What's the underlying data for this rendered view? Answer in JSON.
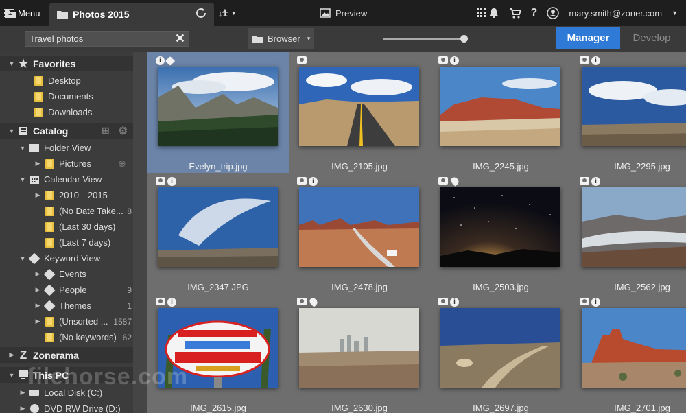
{
  "titlebar": {
    "menu_label": "Menu",
    "tab_title": "Photos 2015",
    "account": "mary.smith@zoner.com"
  },
  "toolbar": {
    "search_value": "Travel photos",
    "browser_label": "Browser",
    "preview_label": "Preview",
    "manager_label": "Manager",
    "develop_label": "Develop",
    "accent": "#2f7ad6"
  },
  "sidebar": {
    "favorites": "Favorites",
    "desktop": "Desktop",
    "documents": "Documents",
    "downloads": "Downloads",
    "catalog": "Catalog",
    "folder_view": "Folder View",
    "pictures": "Pictures",
    "calendar_view": "Calendar View",
    "cal_items": [
      {
        "label": "2010—2015",
        "count": ""
      },
      {
        "label": "(No Date Take...",
        "count": "8"
      },
      {
        "label": "(Last 30 days)",
        "count": ""
      },
      {
        "label": "(Last 7 days)",
        "count": ""
      }
    ],
    "keyword_view": "Keyword View",
    "kw_items": [
      {
        "label": "Events",
        "count": ""
      },
      {
        "label": "People",
        "count": "9"
      },
      {
        "label": "Themes",
        "count": "1"
      },
      {
        "label": "(Unsorted ...",
        "count": "1587"
      },
      {
        "label": "(No keywords)",
        "count": "62"
      }
    ],
    "zonerama": "Zonerama",
    "this_pc": "This PC",
    "local_disk": "Local Disk (C:)",
    "dvd": "DVD RW Drive (D:)"
  },
  "files": [
    {
      "name": "Evelyn_trip.jpg",
      "meta": [
        "info",
        "tag"
      ],
      "selected": true
    },
    {
      "name": "IMG_2105.jpg",
      "meta": [
        "camera"
      ]
    },
    {
      "name": "IMG_2245.jpg",
      "meta": [
        "camera",
        "info"
      ]
    },
    {
      "name": "IMG_2295.jpg",
      "meta": [
        "camera",
        "info"
      ]
    },
    {
      "name": "IMG_2347.JPG",
      "meta": [
        "camera",
        "info"
      ]
    },
    {
      "name": "IMG_2478.jpg",
      "meta": [
        "camera",
        "info"
      ]
    },
    {
      "name": "IMG_2503.jpg",
      "meta": [
        "camera",
        "pin"
      ]
    },
    {
      "name": "IMG_2562.jpg",
      "meta": [
        "camera",
        "info"
      ]
    },
    {
      "name": "IMG_2615.jpg",
      "meta": [
        "camera",
        "info"
      ]
    },
    {
      "name": "IMG_2630.jpg",
      "meta": [
        "camera",
        "pin"
      ]
    },
    {
      "name": "IMG_2697.jpg",
      "meta": [
        "camera",
        "info"
      ]
    },
    {
      "name": "IMG_2701.jpg",
      "meta": [
        "camera",
        "info"
      ]
    }
  ],
  "watermark": "filehorse.com"
}
